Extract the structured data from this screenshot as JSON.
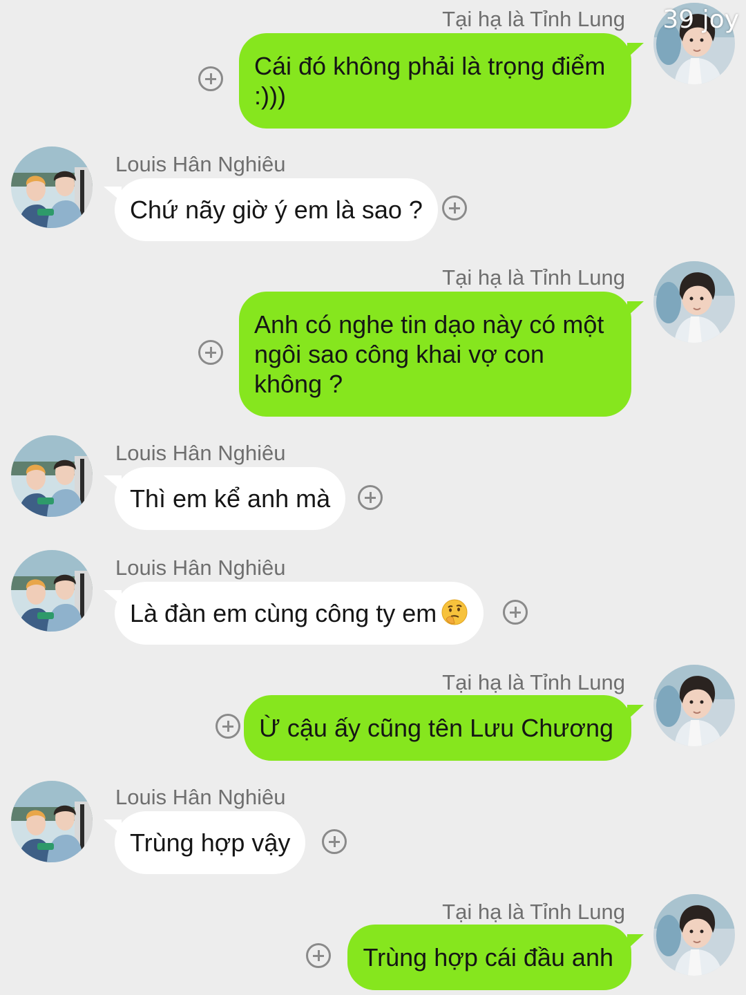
{
  "watermark": "39 joy",
  "messages": [
    {
      "direction": "out",
      "sender": "Tại hạ là Tỉnh Lung",
      "text": "Cái đó không phải là trọng điểm :)))"
    },
    {
      "direction": "in",
      "sender": "Louis Hân Nghiêu",
      "text": "Chứ nãy giờ ý em là sao ?"
    },
    {
      "direction": "out",
      "sender": "Tại hạ là Tỉnh Lung",
      "text": "Anh có nghe tin dạo này có một ngôi sao công khai vợ con không ?"
    },
    {
      "direction": "in",
      "sender": "Louis Hân Nghiêu",
      "text": "Thì em kể anh mà"
    },
    {
      "direction": "in",
      "sender": "Louis Hân Nghiêu",
      "text": "Là đàn em cùng công ty em",
      "emoji": "thinking-face"
    },
    {
      "direction": "out",
      "sender": "Tại hạ là Tỉnh Lung",
      "text": "Ừ cậu ấy cũng tên Lưu Chương"
    },
    {
      "direction": "in",
      "sender": "Louis Hân Nghiêu",
      "text": "Trùng hợp vậy"
    },
    {
      "direction": "out",
      "sender": "Tại hạ là Tỉnh Lung",
      "text": "Trùng hợp cái đầu anh"
    }
  ],
  "icons": {
    "add": "plus-circle-icon",
    "avatar_out": "profile-photo-tinh-lung",
    "avatar_in": "profile-photo-louis"
  },
  "colors": {
    "background": "#ededed",
    "outgoing_bubble": "#86e61e",
    "incoming_bubble": "#ffffff",
    "sender_name": "#6f6f6f",
    "add_icon": "#8a8a8a"
  }
}
